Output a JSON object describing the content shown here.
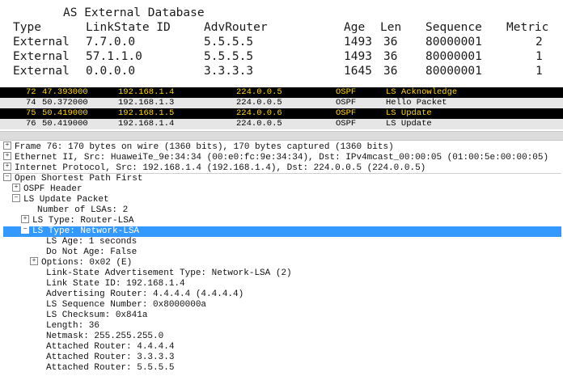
{
  "as_database": {
    "title": "AS External Database",
    "headers": [
      "Type",
      "LinkState ID",
      "AdvRouter",
      "Age",
      "Len",
      "Sequence",
      "Metric"
    ],
    "rows": [
      [
        "External",
        "7.7.0.0",
        "5.5.5.5",
        "1493",
        "36",
        "80000001",
        "2"
      ],
      [
        "External",
        "57.1.1.0",
        "5.5.5.5",
        "1493",
        "36",
        "80000001",
        "1"
      ],
      [
        "External",
        "0.0.0.0",
        "3.3.3.3",
        "1645",
        "36",
        "80000001",
        "1"
      ]
    ]
  },
  "packet_list": {
    "rows": [
      {
        "no": "72",
        "time": "47.393000",
        "src": "192.168.1.4",
        "dst": "224.0.0.5",
        "proto": "OSPF",
        "info": "LS Acknowledge",
        "style": "black"
      },
      {
        "no": "74",
        "time": "50.372000",
        "src": "192.168.1.3",
        "dst": "224.0.0.5",
        "proto": "OSPF",
        "info": "Hello Packet",
        "style": "light"
      },
      {
        "no": "75",
        "time": "50.419000",
        "src": "192.168.1.5",
        "dst": "224.0.0.6",
        "proto": "OSPF",
        "info": "LS Update",
        "style": "black"
      },
      {
        "no": "76",
        "time": "50.419000",
        "src": "192.168.1.4",
        "dst": "224.0.0.5",
        "proto": "OSPF",
        "info": "LS Update",
        "style": "light"
      }
    ],
    "colors": {
      "black_bg": "#000000",
      "black_fg": "#ffd700",
      "light_bg": "#e6e6e6",
      "light_fg": "#000000",
      "selection": "#3399ff"
    }
  },
  "details": [
    {
      "text": "Frame 76: 170 bytes on wire (1360 bits), 170 bytes captured (1360 bits)",
      "toggle": "+"
    },
    {
      "text": "Ethernet II, Src: HuaweiTe_9e:34:34 (00:e0:fc:9e:34:34), Dst: IPv4mcast_00:00:05 (01:00:5e:00:00:05)",
      "toggle": "+"
    },
    {
      "text": "Internet Protocol, Src: 192.168.1.4 (192.168.1.4), Dst: 224.0.0.5 (224.0.0.5)",
      "toggle": "+"
    },
    {
      "text": "Open Shortest Path First",
      "toggle": "-"
    },
    {
      "text": "OSPF Header",
      "toggle": "+"
    },
    {
      "text": "LS Update Packet",
      "toggle": "-"
    },
    {
      "text": "Number of LSAs: 2",
      "toggle": ""
    },
    {
      "text": "LS Type: Router-LSA",
      "toggle": "+"
    },
    {
      "text": "LS Type: Network-LSA",
      "toggle": "-",
      "selected": true
    },
    {
      "text": "LS Age: 1 seconds",
      "toggle": ""
    },
    {
      "text": "Do Not Age: False",
      "toggle": ""
    },
    {
      "text": "Options: 0x02 (E)",
      "toggle": "+"
    },
    {
      "text": "Link-State Advertisement Type: Network-LSA (2)",
      "toggle": ""
    },
    {
      "text": "Link State ID: 192.168.1.4",
      "toggle": ""
    },
    {
      "text": "Advertising Router: 4.4.4.4 (4.4.4.4)",
      "toggle": ""
    },
    {
      "text": "LS Sequence Number: 0x8000000a",
      "toggle": ""
    },
    {
      "text": "LS Checksum: 0x841a",
      "toggle": ""
    },
    {
      "text": "Length: 36",
      "toggle": ""
    },
    {
      "text": "Netmask: 255.255.255.0",
      "toggle": ""
    },
    {
      "text": "Attached Router: 4.4.4.4",
      "toggle": ""
    },
    {
      "text": "Attached Router: 3.3.3.3",
      "toggle": ""
    },
    {
      "text": "Attached Router: 5.5.5.5",
      "toggle": ""
    }
  ]
}
